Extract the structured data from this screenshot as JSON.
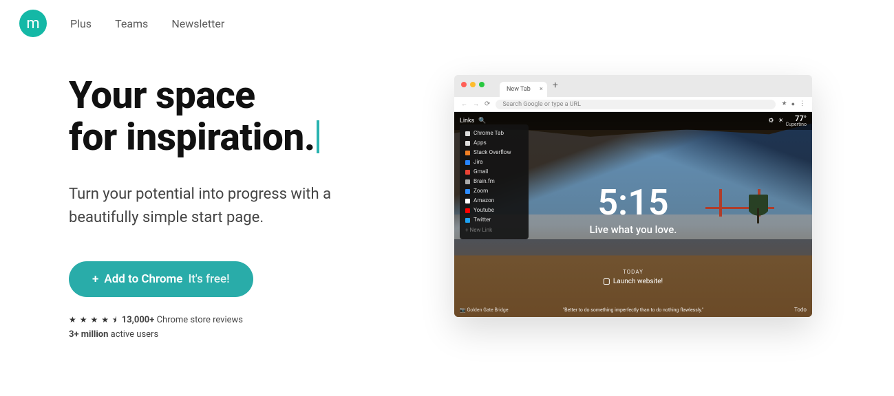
{
  "nav": {
    "logo_letter": "m",
    "items": [
      "Plus",
      "Teams",
      "Newsletter"
    ]
  },
  "hero": {
    "title_line1": "Your space",
    "title_line2": "for inspiration.",
    "subtitle": "Turn your potential into progress with a beautifully simple start page.",
    "cta_prefix": "+",
    "cta_label": "Add to Chrome",
    "cta_note": "It's free!",
    "stars": "★ ★ ★ ★ ⯨",
    "reviews_count": "13,000+",
    "reviews_suffix": "Chrome store reviews",
    "users_count": "3+ million",
    "users_suffix": "active users"
  },
  "shot": {
    "tab_title": "New Tab",
    "url_placeholder": "Search Google or type a URL",
    "topbar_label": "Links",
    "weather_temp": "77°",
    "weather_city": "Cupertino",
    "links": [
      {
        "icon": "#ddd",
        "label": "Chrome Tab"
      },
      {
        "icon": "#ddd",
        "label": "Apps"
      },
      {
        "icon": "#f48024",
        "label": "Stack Overflow"
      },
      {
        "icon": "#2684ff",
        "label": "Jira"
      },
      {
        "icon": "#ea4335",
        "label": "Gmail"
      },
      {
        "icon": "#aaa",
        "label": "Brain.fm"
      },
      {
        "icon": "#2d8cff",
        "label": "Zoom"
      },
      {
        "icon": "#fff",
        "label": "Amazon"
      },
      {
        "icon": "#ff0000",
        "label": "Youtube"
      },
      {
        "icon": "#1da1f2",
        "label": "Twitter"
      }
    ],
    "add_link": "+  New Link",
    "time": "5:15",
    "mantra": "Live what you love.",
    "today_label": "TODAY",
    "today_task": "Launch website!",
    "quote": "\"Better to do something imperfectly than to do nothing flawlessly.\"",
    "photo_credit": "Golden Gate Bridge",
    "todo_label": "Todo"
  }
}
